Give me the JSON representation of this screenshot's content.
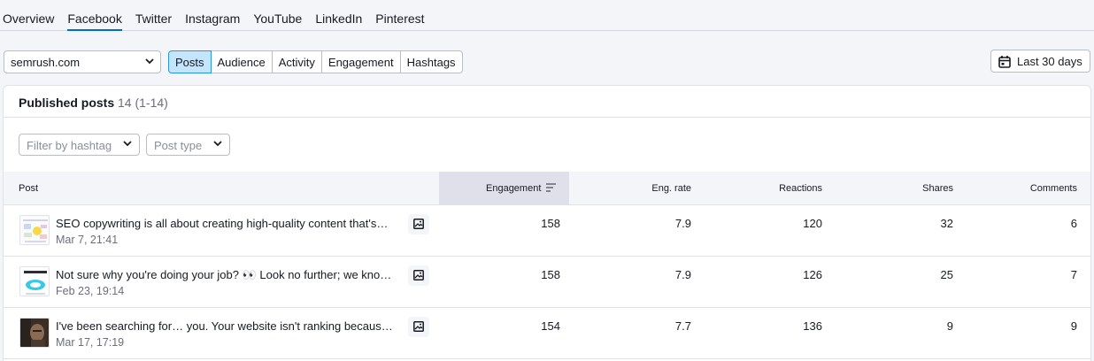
{
  "top_tabs": [
    "Overview",
    "Facebook",
    "Twitter",
    "Instagram",
    "YouTube",
    "LinkedIn",
    "Pinterest"
  ],
  "active_top_tab": "Facebook",
  "domain_select": {
    "value": "semrush.com"
  },
  "view_tabs": [
    "Posts",
    "Audience",
    "Activity",
    "Engagement",
    "Hashtags"
  ],
  "active_view_tab": "Posts",
  "date_range": {
    "label": "Last 30 days"
  },
  "card": {
    "title": "Published posts",
    "count": "14 (1-14)"
  },
  "filters": {
    "hashtag_placeholder": "Filter by hashtag",
    "post_type_placeholder": "Post type"
  },
  "table": {
    "columns": {
      "post": "Post",
      "engagement": "Engagement",
      "eng_rate": "Eng. rate",
      "reactions": "Reactions",
      "shares": "Shares",
      "comments": "Comments"
    },
    "sorted_column": "engagement",
    "rows": [
      {
        "text": "SEO copywriting is all about creating high-quality content that's…",
        "date": "Mar 7, 21:41",
        "engagement": "158",
        "eng_rate": "7.9",
        "reactions": "120",
        "shares": "32",
        "comments": "6",
        "type_icon": "image-icon"
      },
      {
        "text": "Not sure why you're doing your job? 👀 Look no further; we kno…",
        "date": "Feb 23, 19:14",
        "engagement": "158",
        "eng_rate": "7.9",
        "reactions": "126",
        "shares": "25",
        "comments": "7",
        "type_icon": "image-icon"
      },
      {
        "text": "I've been searching for… you. Your website isn't ranking becaus…",
        "date": "Mar 17, 17:19",
        "engagement": "154",
        "eng_rate": "7.7",
        "reactions": "136",
        "shares": "9",
        "comments": "9",
        "type_icon": "image-icon"
      }
    ]
  },
  "colors": {
    "accent": "#006dca",
    "active_segment_bg": "#c4e5fe",
    "sorted_header_bg": "#dfe0ea",
    "muted_text": "#6c6e79"
  }
}
